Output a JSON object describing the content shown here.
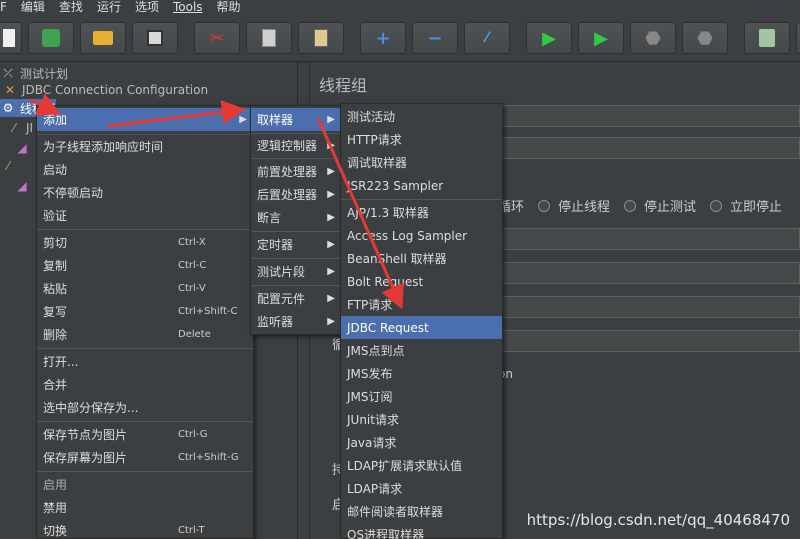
{
  "menubar": [
    "编辑",
    "查找",
    "运行",
    "选项",
    "Tools",
    "帮助"
  ],
  "toolbar_icons": [
    "new-icon",
    "templates-icon",
    "open-icon",
    "save-icon",
    "cut-icon",
    "copy-icon",
    "paste-icon",
    "expand-icon",
    "collapse-icon",
    "toggle-icon",
    "start-icon",
    "start-no-pause-icon",
    "stop-icon",
    "shutdown-icon",
    "clear-icon"
  ],
  "tree": [
    {
      "label": "测试计划",
      "icon": "test-plan-icon"
    },
    {
      "label": "JDBC Connection Configuration",
      "icon": "config-icon"
    },
    {
      "label": "线程组",
      "icon": "thread-group-icon"
    },
    {
      "label": "JI",
      "icon": "sampler-icon"
    },
    {
      "label": "",
      "icon": "listener-icon"
    },
    {
      "label": "",
      "icon": "listener-icon"
    },
    {
      "label": "",
      "icon": "listener-icon"
    }
  ],
  "panel": {
    "title": "线程组",
    "radio_options": [
      "循环",
      "停止线程",
      "停止测试",
      "立即停止"
    ],
    "partial_text": "on",
    "partial_labels": [
      "循",
      "持",
      "启"
    ]
  },
  "context_menu": {
    "items": [
      {
        "label": "添加",
        "shortcut": "",
        "submenu": true,
        "selected": true
      },
      {
        "label": "为子线程添加响应时间",
        "shortcut": ""
      },
      {
        "label": "启动",
        "shortcut": ""
      },
      {
        "label": "不停顿启动",
        "shortcut": ""
      },
      {
        "label": "验证",
        "shortcut": ""
      },
      {
        "label": "剪切",
        "shortcut": "Ctrl-X"
      },
      {
        "label": "复制",
        "shortcut": "Ctrl-C"
      },
      {
        "label": "粘贴",
        "shortcut": "Ctrl-V"
      },
      {
        "label": "复写",
        "shortcut": "Ctrl+Shift-C"
      },
      {
        "label": "删除",
        "shortcut": "Delete"
      },
      {
        "label": "打开...",
        "shortcut": ""
      },
      {
        "label": "合并",
        "shortcut": ""
      },
      {
        "label": "选中部分保存为...",
        "shortcut": ""
      },
      {
        "label": "保存节点为图片",
        "shortcut": "Ctrl-G"
      },
      {
        "label": "保存屏幕为图片",
        "shortcut": "Ctrl+Shift-G"
      },
      {
        "label": "启用",
        "shortcut": ""
      },
      {
        "label": "禁用",
        "shortcut": ""
      },
      {
        "label": "切换",
        "shortcut": "Ctrl-T"
      }
    ]
  },
  "add_submenu": {
    "items": [
      {
        "label": "取样器",
        "selected": true
      },
      {
        "label": "逻辑控制器"
      },
      {
        "label": "前置处理器"
      },
      {
        "label": "后置处理器"
      },
      {
        "label": "断言"
      },
      {
        "label": "定时器"
      },
      {
        "label": "测试片段"
      },
      {
        "label": "配置元件"
      },
      {
        "label": "监听器"
      }
    ]
  },
  "sampler_submenu": {
    "items": [
      {
        "label": "测试活动"
      },
      {
        "label": "HTTP请求"
      },
      {
        "label": "调试取样器"
      },
      {
        "label": "JSR223 Sampler"
      },
      {
        "label": "AJP/1.3 取样器"
      },
      {
        "label": "Access Log Sampler"
      },
      {
        "label": "BeanShell 取样器"
      },
      {
        "label": "Bolt Request"
      },
      {
        "label": "FTP请求"
      },
      {
        "label": "JDBC Request",
        "selected": true
      },
      {
        "label": "JMS点到点"
      },
      {
        "label": "JMS发布"
      },
      {
        "label": "JMS订阅"
      },
      {
        "label": "JUnit请求"
      },
      {
        "label": "Java请求"
      },
      {
        "label": "LDAP扩展请求默认值"
      },
      {
        "label": "LDAP请求"
      },
      {
        "label": "邮件阅读者取样器"
      },
      {
        "label": "OS进程取样器"
      }
    ]
  },
  "colors": {
    "selection": "#4b6eaf",
    "background": "#3c3f41",
    "arrow": "#e53935"
  },
  "watermark": "https://blog.csdn.net/qq_40468470"
}
